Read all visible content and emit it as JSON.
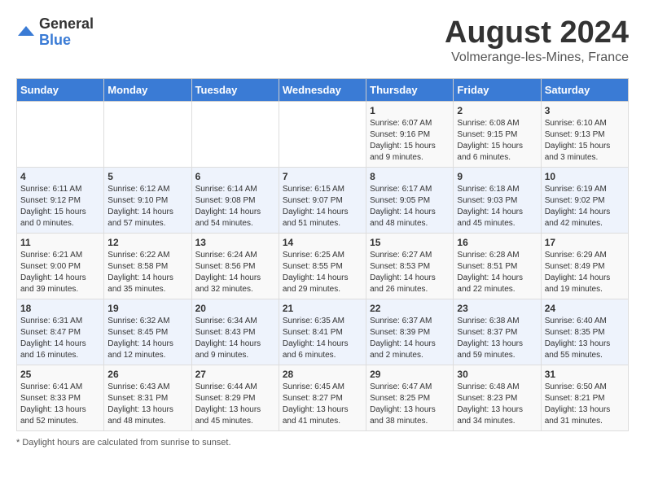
{
  "header": {
    "logo_general": "General",
    "logo_blue": "Blue",
    "month_year": "August 2024",
    "location": "Volmerange-les-Mines, France"
  },
  "days_of_week": [
    "Sunday",
    "Monday",
    "Tuesday",
    "Wednesday",
    "Thursday",
    "Friday",
    "Saturday"
  ],
  "footer": {
    "note": "Daylight hours"
  },
  "weeks": [
    [
      {
        "day": "",
        "content": ""
      },
      {
        "day": "",
        "content": ""
      },
      {
        "day": "",
        "content": ""
      },
      {
        "day": "",
        "content": ""
      },
      {
        "day": "1",
        "content": "Sunrise: 6:07 AM\nSunset: 9:16 PM\nDaylight: 15 hours and 9 minutes."
      },
      {
        "day": "2",
        "content": "Sunrise: 6:08 AM\nSunset: 9:15 PM\nDaylight: 15 hours and 6 minutes."
      },
      {
        "day": "3",
        "content": "Sunrise: 6:10 AM\nSunset: 9:13 PM\nDaylight: 15 hours and 3 minutes."
      }
    ],
    [
      {
        "day": "4",
        "content": "Sunrise: 6:11 AM\nSunset: 9:12 PM\nDaylight: 15 hours and 0 minutes."
      },
      {
        "day": "5",
        "content": "Sunrise: 6:12 AM\nSunset: 9:10 PM\nDaylight: 14 hours and 57 minutes."
      },
      {
        "day": "6",
        "content": "Sunrise: 6:14 AM\nSunset: 9:08 PM\nDaylight: 14 hours and 54 minutes."
      },
      {
        "day": "7",
        "content": "Sunrise: 6:15 AM\nSunset: 9:07 PM\nDaylight: 14 hours and 51 minutes."
      },
      {
        "day": "8",
        "content": "Sunrise: 6:17 AM\nSunset: 9:05 PM\nDaylight: 14 hours and 48 minutes."
      },
      {
        "day": "9",
        "content": "Sunrise: 6:18 AM\nSunset: 9:03 PM\nDaylight: 14 hours and 45 minutes."
      },
      {
        "day": "10",
        "content": "Sunrise: 6:19 AM\nSunset: 9:02 PM\nDaylight: 14 hours and 42 minutes."
      }
    ],
    [
      {
        "day": "11",
        "content": "Sunrise: 6:21 AM\nSunset: 9:00 PM\nDaylight: 14 hours and 39 minutes."
      },
      {
        "day": "12",
        "content": "Sunrise: 6:22 AM\nSunset: 8:58 PM\nDaylight: 14 hours and 35 minutes."
      },
      {
        "day": "13",
        "content": "Sunrise: 6:24 AM\nSunset: 8:56 PM\nDaylight: 14 hours and 32 minutes."
      },
      {
        "day": "14",
        "content": "Sunrise: 6:25 AM\nSunset: 8:55 PM\nDaylight: 14 hours and 29 minutes."
      },
      {
        "day": "15",
        "content": "Sunrise: 6:27 AM\nSunset: 8:53 PM\nDaylight: 14 hours and 26 minutes."
      },
      {
        "day": "16",
        "content": "Sunrise: 6:28 AM\nSunset: 8:51 PM\nDaylight: 14 hours and 22 minutes."
      },
      {
        "day": "17",
        "content": "Sunrise: 6:29 AM\nSunset: 8:49 PM\nDaylight: 14 hours and 19 minutes."
      }
    ],
    [
      {
        "day": "18",
        "content": "Sunrise: 6:31 AM\nSunset: 8:47 PM\nDaylight: 14 hours and 16 minutes."
      },
      {
        "day": "19",
        "content": "Sunrise: 6:32 AM\nSunset: 8:45 PM\nDaylight: 14 hours and 12 minutes."
      },
      {
        "day": "20",
        "content": "Sunrise: 6:34 AM\nSunset: 8:43 PM\nDaylight: 14 hours and 9 minutes."
      },
      {
        "day": "21",
        "content": "Sunrise: 6:35 AM\nSunset: 8:41 PM\nDaylight: 14 hours and 6 minutes."
      },
      {
        "day": "22",
        "content": "Sunrise: 6:37 AM\nSunset: 8:39 PM\nDaylight: 14 hours and 2 minutes."
      },
      {
        "day": "23",
        "content": "Sunrise: 6:38 AM\nSunset: 8:37 PM\nDaylight: 13 hours and 59 minutes."
      },
      {
        "day": "24",
        "content": "Sunrise: 6:40 AM\nSunset: 8:35 PM\nDaylight: 13 hours and 55 minutes."
      }
    ],
    [
      {
        "day": "25",
        "content": "Sunrise: 6:41 AM\nSunset: 8:33 PM\nDaylight: 13 hours and 52 minutes."
      },
      {
        "day": "26",
        "content": "Sunrise: 6:43 AM\nSunset: 8:31 PM\nDaylight: 13 hours and 48 minutes."
      },
      {
        "day": "27",
        "content": "Sunrise: 6:44 AM\nSunset: 8:29 PM\nDaylight: 13 hours and 45 minutes."
      },
      {
        "day": "28",
        "content": "Sunrise: 6:45 AM\nSunset: 8:27 PM\nDaylight: 13 hours and 41 minutes."
      },
      {
        "day": "29",
        "content": "Sunrise: 6:47 AM\nSunset: 8:25 PM\nDaylight: 13 hours and 38 minutes."
      },
      {
        "day": "30",
        "content": "Sunrise: 6:48 AM\nSunset: 8:23 PM\nDaylight: 13 hours and 34 minutes."
      },
      {
        "day": "31",
        "content": "Sunrise: 6:50 AM\nSunset: 8:21 PM\nDaylight: 13 hours and 31 minutes."
      }
    ]
  ]
}
